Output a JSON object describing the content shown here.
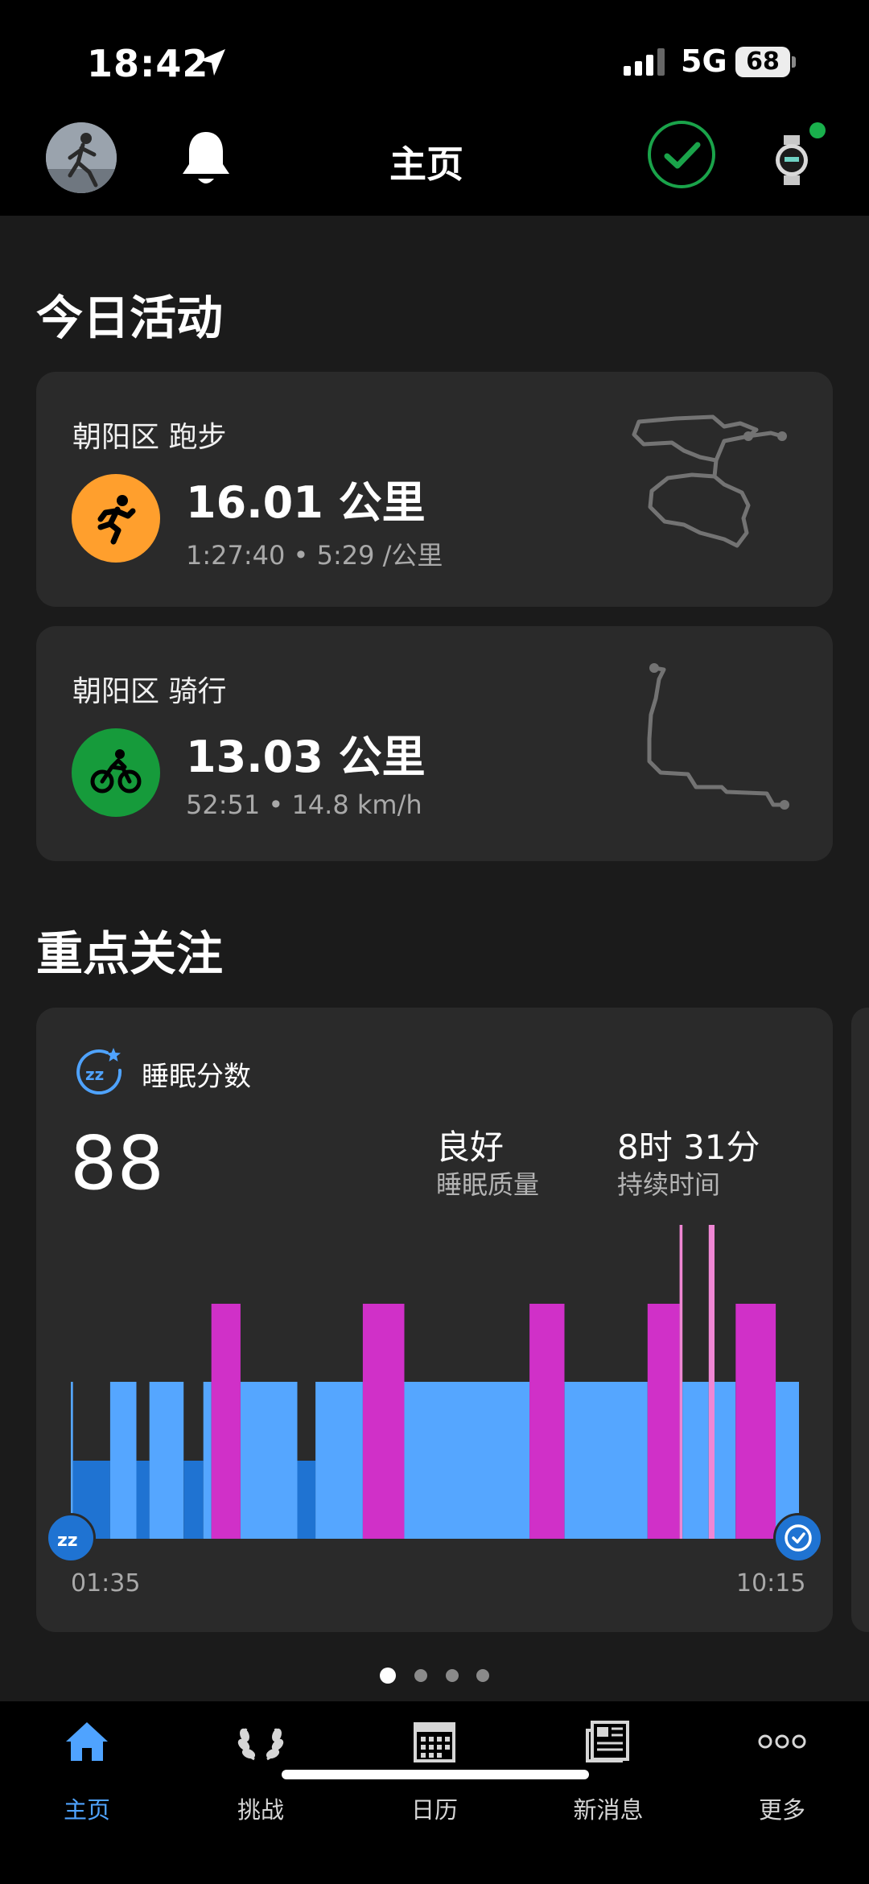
{
  "status_bar": {
    "time": "18:42",
    "network": "5G",
    "battery": "68"
  },
  "header": {
    "title": "主页"
  },
  "today": {
    "heading": "今日活动",
    "activities": [
      {
        "place": "朝阳区 跑步",
        "distance": "16.01 公里",
        "meta": "1:27:40 • 5:29 /公里",
        "icon": "running-icon",
        "color": "#ff9f2d"
      },
      {
        "place": "朝阳区 骑行",
        "distance": "13.03 公里",
        "meta": "52:51 • 14.8 km/h",
        "icon": "cycling-icon",
        "color": "#169b3b"
      }
    ]
  },
  "focus": {
    "heading": "重点关注",
    "sleep": {
      "title": "睡眠分数",
      "score": "88",
      "quality_value": "良好",
      "quality_label": "睡眠质量",
      "duration_value": "8时 31分",
      "duration_label": "持续时间",
      "start_time": "01:35",
      "end_time": "10:15"
    },
    "page_count": 4,
    "current_page": 1
  },
  "chart_data": {
    "type": "bar",
    "title": "睡眠分数",
    "x_range": [
      "01:35",
      "10:15"
    ],
    "stage_levels": {
      "deep": 1,
      "light": 2,
      "rem": 3,
      "awake": 4
    },
    "colors": {
      "deep": "#1f73d2",
      "light": "#55a6ff",
      "rem": "#d030c8",
      "awake": "#ef87d4"
    },
    "segments": [
      {
        "stage": "light",
        "from": 0.0,
        "to": 0.003
      },
      {
        "stage": "deep",
        "from": 0.003,
        "to": 0.054
      },
      {
        "stage": "light",
        "from": 0.054,
        "to": 0.09
      },
      {
        "stage": "deep",
        "from": 0.09,
        "to": 0.108
      },
      {
        "stage": "light",
        "from": 0.108,
        "to": 0.155
      },
      {
        "stage": "deep",
        "from": 0.155,
        "to": 0.182
      },
      {
        "stage": "light",
        "from": 0.182,
        "to": 0.193
      },
      {
        "stage": "rem",
        "from": 0.193,
        "to": 0.233
      },
      {
        "stage": "light",
        "from": 0.233,
        "to": 0.311
      },
      {
        "stage": "deep",
        "from": 0.311,
        "to": 0.336
      },
      {
        "stage": "light",
        "from": 0.336,
        "to": 0.401
      },
      {
        "stage": "rem",
        "from": 0.401,
        "to": 0.458
      },
      {
        "stage": "light",
        "from": 0.458,
        "to": 0.63
      },
      {
        "stage": "rem",
        "from": 0.63,
        "to": 0.678
      },
      {
        "stage": "light",
        "from": 0.678,
        "to": 0.792
      },
      {
        "stage": "rem",
        "from": 0.792,
        "to": 0.836
      },
      {
        "stage": "awake",
        "from": 0.836,
        "to": 0.84
      },
      {
        "stage": "light",
        "from": 0.84,
        "to": 0.876
      },
      {
        "stage": "awake",
        "from": 0.876,
        "to": 0.884
      },
      {
        "stage": "light",
        "from": 0.884,
        "to": 0.913
      },
      {
        "stage": "rem",
        "from": 0.913,
        "to": 0.968
      },
      {
        "stage": "light",
        "from": 0.968,
        "to": 1.0
      }
    ]
  },
  "tabs": [
    {
      "label": "主页",
      "icon": "home-icon",
      "active": true
    },
    {
      "label": "挑战",
      "icon": "laurel-icon",
      "active": false
    },
    {
      "label": "日历",
      "icon": "calendar-icon",
      "active": false
    },
    {
      "label": "新消息",
      "icon": "news-icon",
      "active": false
    },
    {
      "label": "更多",
      "icon": "more-icon",
      "active": false
    }
  ],
  "colors": {
    "accent": "#4fa3ff",
    "sync_ok": "#1aa34a",
    "card_bg": "#2a2a2a"
  }
}
